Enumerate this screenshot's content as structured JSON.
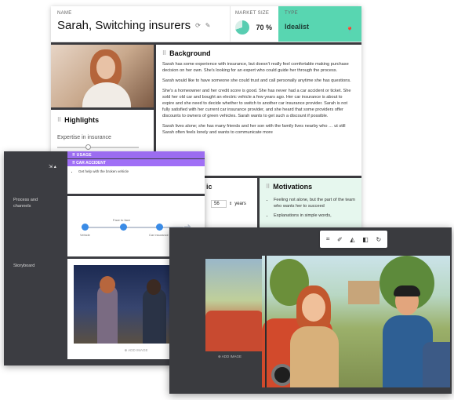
{
  "persona": {
    "name_label": "NAME",
    "name": "Sarah, Switching insurers",
    "market_label": "MARKET SIZE",
    "market_value": "70 %",
    "market_fraction": 0.7,
    "type_label": "TYPE",
    "type_value": "Idealist",
    "highlights_title": "Highlights",
    "highlight_item": "Expertise in insurance",
    "highlight_level": 0.35,
    "background_title": "Background",
    "background_paragraphs": [
      "Sarah has some experience with insurance, but doesn't really feel comfortable making purchase decision on her own. She's looking for an expert who could guide her through the process.",
      "Sarah would like to have someone she could trust and call personally anytime she has questions.",
      "She's a homeowner and her credit score is good. She has never had a car accident or ticket. She sold her old car and bought an electric vehicle a few years ago. Her car insurance is about to expire and she need to decide whether to switch to another car insurance provider. Sarah is not fully satisfied with her current car insurance provider, and she heard that some providers offer discounts to owners of green vehicles. Sarah wants to get such a discount if possible.",
      "Sarah lives alone; she has many friends and her son with the family lives nearby who … ut still Sarah often feels lonely and wants to communicate more"
    ],
    "demo_title_fragment": "ic",
    "age_value": "56",
    "age_unit": "years",
    "motivations_title": "Motivations",
    "motivations": [
      "Feeling not alone, but the part of the team who wants her to succeed",
      "Explanations in simple words,"
    ]
  },
  "storyboard": {
    "side_labels": [
      "Process and channels",
      "Storyboard"
    ],
    "usage_label": "USAGE",
    "scenario_label": "CAR ACCIDENT",
    "task": "Get help with the broken vehicle",
    "flow_nodes": [
      "Vehicle",
      "Face to face",
      "Car insurance"
    ],
    "add_image": "ADD IMAGE"
  },
  "editor": {
    "tools": [
      "crop-icon",
      "eraser-icon",
      "flip-icon",
      "align-icon",
      "rotate-icon"
    ],
    "add_image": "ADD IMAGE"
  },
  "colors": {
    "type_bg": "#58d6b1",
    "usage_bg": "#9b6cf0",
    "motivations_bg": "#e6f7ee",
    "sidebar_bg": "#3c3d42"
  }
}
